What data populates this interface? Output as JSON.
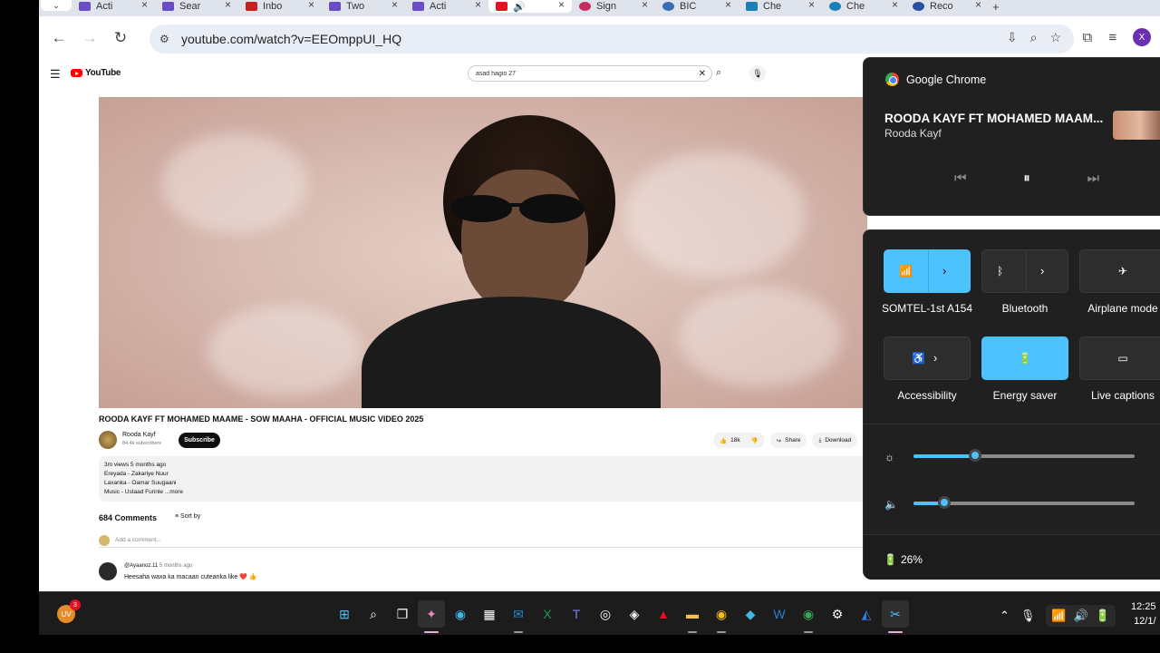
{
  "browser": {
    "tabs": [
      {
        "label": "Acti",
        "color": "#6b4cc7"
      },
      {
        "label": "Sear",
        "color": "#6b4cc7"
      },
      {
        "label": "Inbo",
        "color": "#c5221f"
      },
      {
        "label": "Two",
        "color": "#6b4cc7"
      },
      {
        "label": "Acti",
        "color": "#6b4cc7"
      },
      {
        "label": "",
        "color": "#e81123"
      },
      {
        "label": "Sign",
        "color": "#c72a5e"
      },
      {
        "label": "BIC",
        "color": "#3b6db3"
      },
      {
        "label": "Che",
        "color": "#1a7fb5"
      },
      {
        "label": "Che",
        "color": "#1a7fb5"
      },
      {
        "label": "Reco",
        "color": "#2a4fa0"
      }
    ],
    "url": "youtube.com/watch?v=EEOmppUI_HQ",
    "profile_initial": "X"
  },
  "youtube": {
    "logo_text": "YouTube",
    "search_value": "asad hagio 27",
    "video_title": "ROODA KAYF FT MOHAMED MAAME - SOW MAAHA - OFFICIAL MUSIC VIDEO 2025",
    "channel_name": "Rooda Kayf",
    "channel_subs": "84.4k subscribers",
    "subscribe_label": "Subscribe",
    "likes": "18k",
    "share_label": "Share",
    "download_label": "Download",
    "description_lines": [
      "3m views  5 months ago",
      "Ereyada - Zakariye Nuur",
      "Laxanka - Oamar Suugaani",
      "Music - Ustaad Furinle ...more"
    ],
    "comments_count": "684 Comments",
    "sort_label": "Sort by",
    "add_comment_placeholder": "Add a comment...",
    "comment": {
      "user": "@Ayaanoz.11",
      "time": "5 months ago",
      "text": "Heesaha waxa ka macaan cuteanka like ❤️ 👍"
    }
  },
  "media_flyout": {
    "source_app": "Google Chrome",
    "title": "ROODA KAYF FT MOHAMED MAAM...",
    "artist": "Rooda Kayf"
  },
  "quick_settings": {
    "tiles": [
      {
        "label": "SOMTEL-1st A154",
        "icon": "wifi-icon",
        "on": true
      },
      {
        "label": "Bluetooth",
        "icon": "bluetooth-icon",
        "on": false
      },
      {
        "label": "Airplane mode",
        "icon": "airplane-icon",
        "on": false
      },
      {
        "label": "Accessibility",
        "icon": "accessibility-icon",
        "on": false
      },
      {
        "label": "Energy saver",
        "icon": "energy-saver-icon",
        "on": true
      },
      {
        "label": "Live captions",
        "icon": "captions-icon",
        "on": false
      }
    ],
    "brightness_percent": 28,
    "volume_percent": 14,
    "battery_percent": "26%",
    "accent_color": "#4cc2ff"
  },
  "taskbar": {
    "user_initials": "UV",
    "notification_count": "3",
    "clock_time": "12:25",
    "clock_date": "12/1/"
  }
}
